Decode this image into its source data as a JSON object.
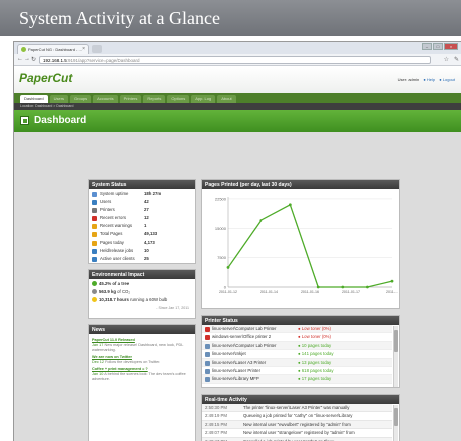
{
  "banner": {
    "title": "System Activity at a Glance"
  },
  "browser": {
    "tab_title": "PaperCut NG : Dashboard - ...",
    "url_host": "192.168.1.5",
    "url_path": ":9191/app?service=page/Dashboard"
  },
  "header": {
    "logo": "PaperCut",
    "user_label": "User: admin",
    "help": "Help",
    "logout": "Logout"
  },
  "nav": {
    "tabs": [
      "Dashboard",
      "Users",
      "Groups",
      "Accounts",
      "Printers",
      "Reports",
      "Options",
      "App. Log",
      "About"
    ],
    "active": 0
  },
  "breadcrumb": "Location: Dashboard > Dashboard",
  "page_title": "Dashboard",
  "system_status": {
    "title": "System Status",
    "rows": [
      {
        "label": "System uptime",
        "value": "18h 27m",
        "icon": "clock-icon",
        "color": "#5b8fd0"
      },
      {
        "label": "Users",
        "value": "42",
        "icon": "users-icon",
        "color": "#3a7fc0"
      },
      {
        "label": "Printers",
        "value": "27",
        "icon": "printer-icon",
        "color": "#777777"
      },
      {
        "label": "Recent errors",
        "value": "12",
        "icon": "error-icon",
        "color": "#d0302a"
      },
      {
        "label": "Recent warnings",
        "value": "1",
        "icon": "warning-icon",
        "color": "#e6a516"
      },
      {
        "label": "Total Pages",
        "value": "49,133",
        "icon": "pages-icon",
        "color": "#e6a516"
      },
      {
        "label": "Pages today",
        "value": "4,173",
        "icon": "pages-today-icon",
        "color": "#e6a516"
      },
      {
        "label": "Held/release jobs",
        "value": "10",
        "icon": "hold-icon",
        "color": "#3a7fc0"
      },
      {
        "label": "Active user clients",
        "value": "25",
        "icon": "client-icon",
        "color": "#3a7fc0"
      }
    ]
  },
  "environment": {
    "title": "Environmental Impact",
    "trees": "45.2% of a tree",
    "co2_value": "563.9 kg",
    "co2_suffix": "of CO₂",
    "bulb_value": "10,318.7 hours",
    "bulb_suffix": "running a 60W bulb",
    "since": "- Since Jan 17, 2011"
  },
  "news": {
    "title": "News",
    "items": [
      {
        "title": "PaperCut 11.0 Released",
        "date": "Jan 17",
        "body": "New major release! Dashboard, new look, PDL watermarking."
      },
      {
        "title": "We are now on Twitter",
        "date": "Dec 12",
        "body": "Follow the developers on Twitter."
      },
      {
        "title": "Coffee + print management = ?",
        "date": "Jan 10",
        "body": "A behind the scenes look: The dev team's coffee adventure."
      }
    ]
  },
  "pages_chart": {
    "title": "Pages Printed (per day, last 30 days)"
  },
  "chart_data": {
    "type": "line",
    "title": "Pages Printed (per day, last 30 days)",
    "x": [
      "2011-01-12",
      "2011-01-14",
      "2011-01-16",
      "2011-01-17",
      "2011-01-18"
    ],
    "x_tick_labels": [
      "2011-01-12",
      "2011-01-14",
      "2011-01-16",
      "2011-01-17",
      "2011-..."
    ],
    "y": [
      5000,
      17000,
      21000,
      0,
      0,
      0,
      1500
    ],
    "x_points": [
      0,
      0.2,
      0.38,
      0.55,
      0.7,
      0.85,
      1.0
    ],
    "y_ticks": [
      0,
      7500,
      15000,
      22500
    ],
    "ylim": [
      0,
      23000
    ],
    "xlabel": "",
    "ylabel": "",
    "grid": true,
    "line_color": "#4eab29"
  },
  "printer_status": {
    "title": "Printer Status",
    "rows": [
      {
        "name": "linux-server\\Computer Lab Printer",
        "status": "Low toner (0%)",
        "level": "error"
      },
      {
        "name": "windows-server\\Office printer 2",
        "status": "Low toner (0%)",
        "level": "error"
      },
      {
        "name": "linux-server\\Computer Lab Printer",
        "status": "10 pages today",
        "level": "ok"
      },
      {
        "name": "linux-server\\Inkjet",
        "status": "141 pages today",
        "level": "ok"
      },
      {
        "name": "linux-server\\Laser A3 Printer",
        "status": "13 pages today",
        "level": "ok"
      },
      {
        "name": "linux-server\\Laser Printer",
        "status": "618 pages today",
        "level": "ok"
      },
      {
        "name": "linux-server\\Library MFP",
        "status": "17 pages today",
        "level": "ok"
      }
    ]
  },
  "activity": {
    "title": "Real-time Activity",
    "rows": [
      {
        "time": "2:50:30 PM",
        "msg": "The printer \"linux-server\\Laser A3 Printer\" was manually"
      },
      {
        "time": "2:49:19 PM",
        "msg": "Queueing a job printed for \"cathy\" on \"linux-server\\Library"
      },
      {
        "time": "2:49:15 PM",
        "msg": "New internal user \"ewvulbert\" registered by \"admin\" from"
      },
      {
        "time": "2:49:07 PM",
        "msg": "New internal user \"strangelove\" registered by \"admin\" from"
      },
      {
        "time": "2:49:47 PM",
        "msg": "Cancelled a job printed by user \"cathy\" on \"linux-"
      }
    ]
  }
}
